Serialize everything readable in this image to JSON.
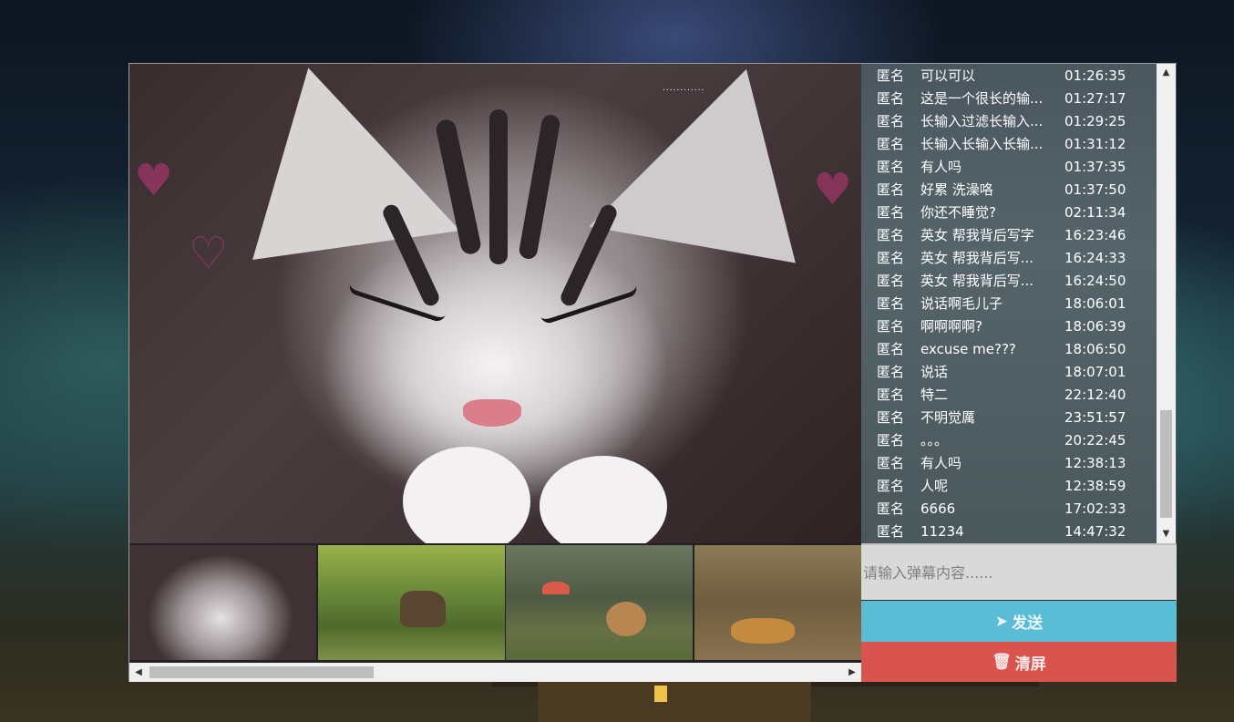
{
  "danmaku": {
    "messages": [
      {
        "name": "匿名",
        "text": "可以可以",
        "time": "01:26:35"
      },
      {
        "name": "匿名",
        "text": "这是一个很长的输...",
        "time": "01:27:17"
      },
      {
        "name": "匿名",
        "text": "长输入过滤长输入...",
        "time": "01:29:25"
      },
      {
        "name": "匿名",
        "text": "长输入长输入长输...",
        "time": "01:31:12"
      },
      {
        "name": "匿名",
        "text": "有人吗",
        "time": "01:37:35"
      },
      {
        "name": "匿名",
        "text": "好累 洗澡咯",
        "time": "01:37:50"
      },
      {
        "name": "匿名",
        "text": "你还不睡觉?",
        "time": "02:11:34"
      },
      {
        "name": "匿名",
        "text": "英女 帮我背后写字",
        "time": "16:23:46"
      },
      {
        "name": "匿名",
        "text": "英女 帮我背后写...",
        "time": "16:24:33"
      },
      {
        "name": "匿名",
        "text": "英女 帮我背后写...",
        "time": "16:24:50"
      },
      {
        "name": "匿名",
        "text": "说话啊毛儿子",
        "time": "18:06:01"
      },
      {
        "name": "匿名",
        "text": "啊啊啊啊?",
        "time": "18:06:39"
      },
      {
        "name": "匿名",
        "text": "excuse me???",
        "time": "18:06:50"
      },
      {
        "name": "匿名",
        "text": "说话",
        "time": "18:07:01"
      },
      {
        "name": "匿名",
        "text": "特二",
        "time": "22:12:40"
      },
      {
        "name": "匿名",
        "text": "不明觉厲",
        "time": "23:51:57"
      },
      {
        "name": "匿名",
        "text": "。。。",
        "time": "20:22:45"
      },
      {
        "name": "匿名",
        "text": "有人吗",
        "time": "12:38:13"
      },
      {
        "name": "匿名",
        "text": "人呢",
        "time": "12:38:59"
      },
      {
        "name": "匿名",
        "text": "6666",
        "time": "17:02:33"
      },
      {
        "name": "匿名",
        "text": "11234",
        "time": "14:47:32"
      }
    ]
  },
  "stage": {
    "indicator": "............"
  },
  "input": {
    "placeholder": "请输入弹幕内容......"
  },
  "buttons": {
    "send_label": "发送",
    "clear_label": "清屏"
  },
  "icons": {
    "send": "paper-plane-icon",
    "clear": "trash-icon"
  },
  "colors": {
    "send": "#5bbcd6",
    "clear": "#d9534f"
  }
}
